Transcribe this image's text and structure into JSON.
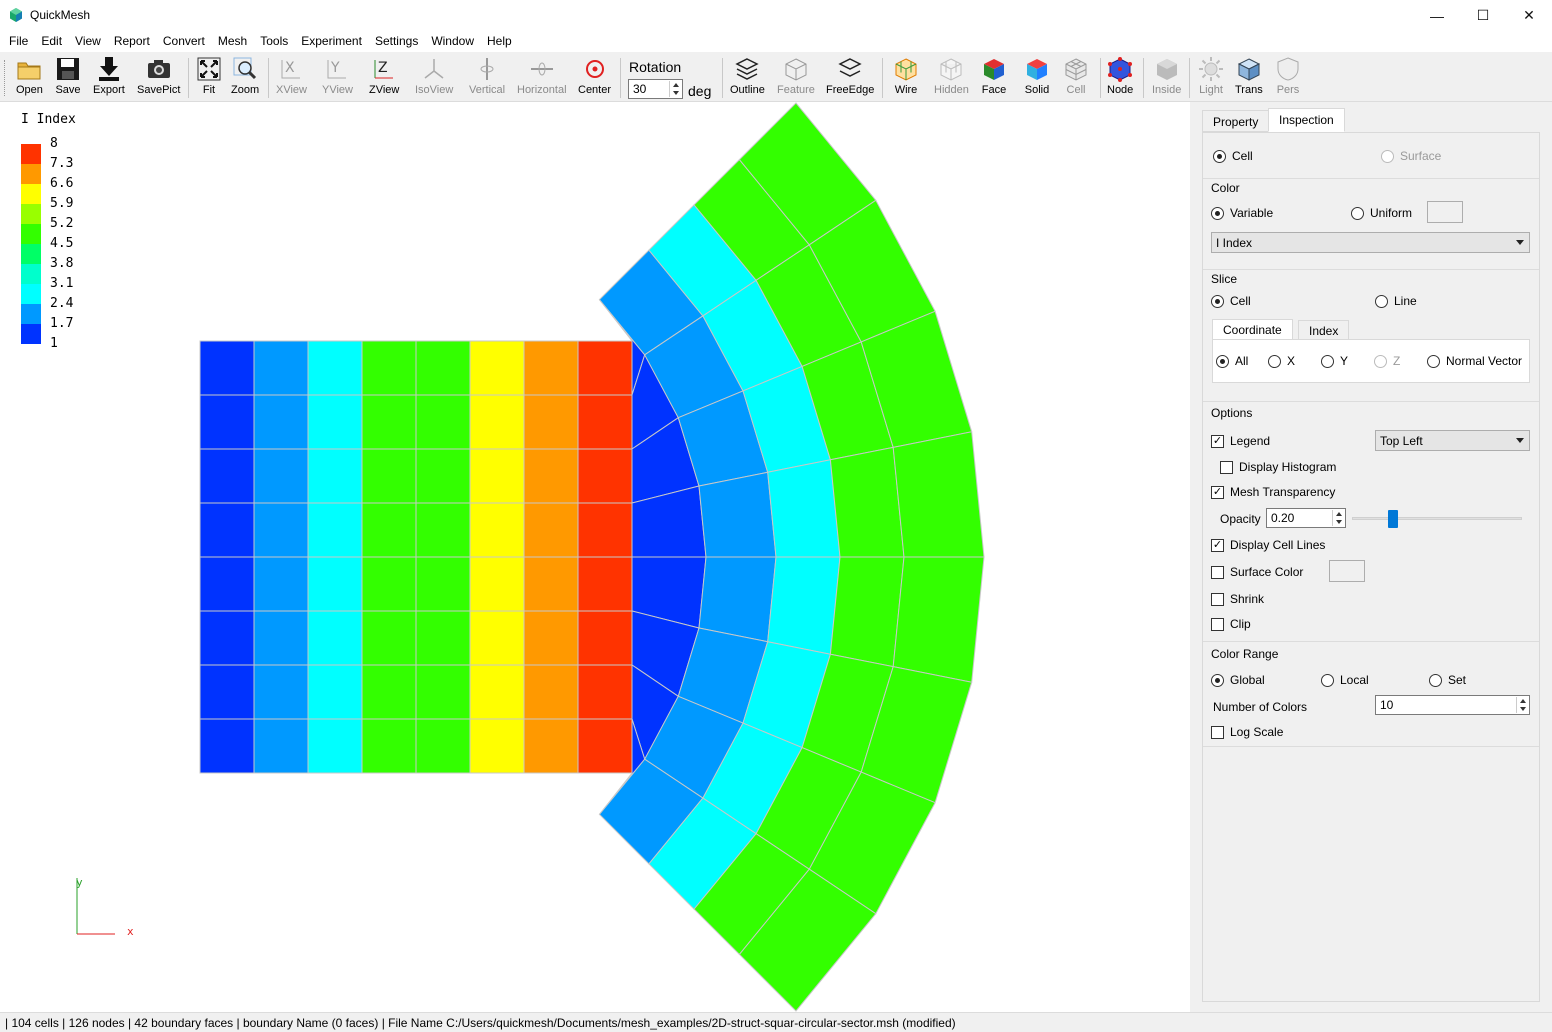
{
  "window": {
    "title": "QuickMesh",
    "minimize": "—",
    "maximize": "☐",
    "close": "✕"
  },
  "menu": [
    "File",
    "Edit",
    "View",
    "Report",
    "Convert",
    "Mesh",
    "Tools",
    "Experiment",
    "Settings",
    "Window",
    "Help"
  ],
  "toolbar": {
    "open": "Open",
    "save": "Save",
    "export": "Export",
    "savepict": "SavePict",
    "fit": "Fit",
    "zoom": "Zoom",
    "xview": "XView",
    "yview": "YView",
    "zview": "ZView",
    "isoview": "IsoView",
    "vertical": "Vertical",
    "horizontal": "Horizontal",
    "center": "Center",
    "rotation_label": "Rotation",
    "rotation_value": "30",
    "rotation_unit": "deg",
    "outline": "Outline",
    "feature": "Feature",
    "freeedge": "FreeEdge",
    "wire": "Wire",
    "hidden": "Hidden",
    "face": "Face",
    "solid": "Solid",
    "cell": "Cell",
    "node": "Node",
    "inside": "Inside",
    "light": "Light",
    "trans": "Trans",
    "pers": "Pers"
  },
  "legend": {
    "title": "I Index",
    "labels": [
      "8",
      "7.3",
      "6.6",
      "5.9",
      "5.2",
      "4.5",
      "3.8",
      "3.1",
      "2.4",
      "1.7",
      "1"
    ],
    "colors": [
      "#ff3300",
      "#ff9900",
      "#ffff00",
      "#99ff00",
      "#33ff00",
      "#00ff66",
      "#00ffcc",
      "#00ffff",
      "#0099ff",
      "#0033ff"
    ]
  },
  "axes": {
    "y": "y",
    "x": "x"
  },
  "mesh_colors": {
    "square_columns": [
      "#0033ff",
      "#0099ff",
      "#00ffff",
      "#33ff00",
      "#33ff00",
      "#ffff00",
      "#ff9900",
      "#ff3300"
    ],
    "sector_rings": [
      "#0033ff",
      "#0099ff",
      "#00ffff",
      "#33ff00",
      "#33ff00"
    ]
  },
  "panel": {
    "tabs": [
      "Property",
      "Inspection"
    ],
    "mode": {
      "cell": "Cell",
      "surface": "Surface"
    },
    "color": {
      "title": "Color",
      "variable": "Variable",
      "uniform": "Uniform",
      "variable_select": "I Index"
    },
    "slice": {
      "title": "Slice",
      "cell": "Cell",
      "line": "Line",
      "subtabs": [
        "Coordinate",
        "Index"
      ],
      "all": "All",
      "x": "X",
      "y": "Y",
      "z": "Z",
      "normal": "Normal Vector"
    },
    "options": {
      "title": "Options",
      "legend": "Legend",
      "legend_pos": "Top Left",
      "histogram": "Display Histogram",
      "transparency": "Mesh Transparency",
      "opacity_label": "Opacity",
      "opacity_value": "0.20",
      "opacity_level": 0.2,
      "cell_lines": "Display Cell Lines",
      "surface_color": "Surface Color",
      "shrink": "Shrink",
      "clip": "Clip"
    },
    "range": {
      "title": "Color Range",
      "global": "Global",
      "local": "Local",
      "set": "Set",
      "num_colors_label": "Number of Colors",
      "num_colors": "10",
      "log": "Log Scale"
    }
  },
  "status": "| 104 cells | 126 nodes | 42 boundary faces |  boundary Name  (0 faces) | File Name C:/Users/quickmesh/Documents/mesh_examples/2D-struct-squar-circular-sector.msh (modified)"
}
